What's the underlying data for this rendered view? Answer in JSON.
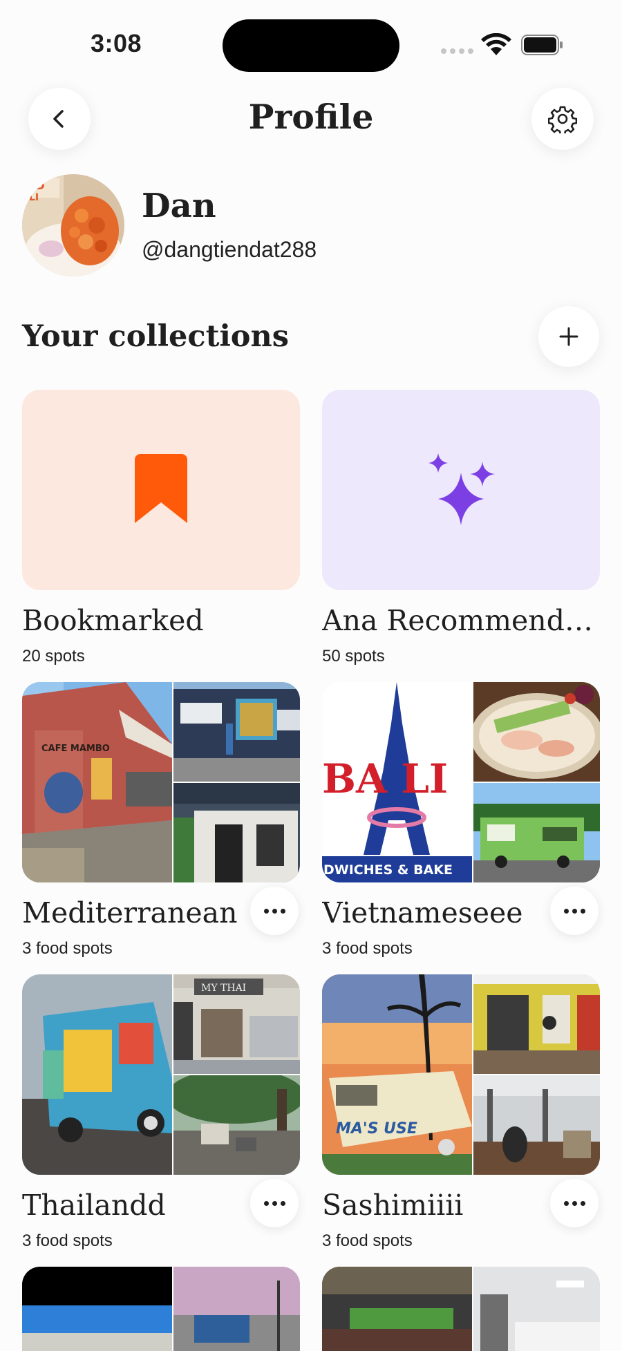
{
  "status_bar": {
    "time": "3:08"
  },
  "header": {
    "title": "Profile"
  },
  "profile": {
    "name": "Dan",
    "handle": "@dangtiendat288"
  },
  "collections_section": {
    "title": "Your collections"
  },
  "collections": [
    {
      "title": "Bookmarked",
      "count": "20 spots",
      "cover_color": "#fde8e0",
      "icon": "bookmark-icon",
      "icon_color": "#ff5a0a"
    },
    {
      "title": "Ana Recommendations",
      "count": "50 spots",
      "cover_color": "#ede8fc",
      "icon": "sparkles-icon",
      "icon_color": "#7b3fe4"
    },
    {
      "title": "Mediterranean",
      "count": "3 food spots"
    },
    {
      "title": "Vietnameseee",
      "count": "3 food spots"
    },
    {
      "title": "Thailandd",
      "count": "3 food spots"
    },
    {
      "title": "Sashimiiii",
      "count": "3 food spots"
    }
  ],
  "photo_text": {
    "cafe_mambo": "CAFE MAMBO",
    "bali": "BA LI",
    "bali_sub": "DWICHES & BAKE",
    "my_thai": "MY THAI",
    "boat": "MA'S USE"
  }
}
